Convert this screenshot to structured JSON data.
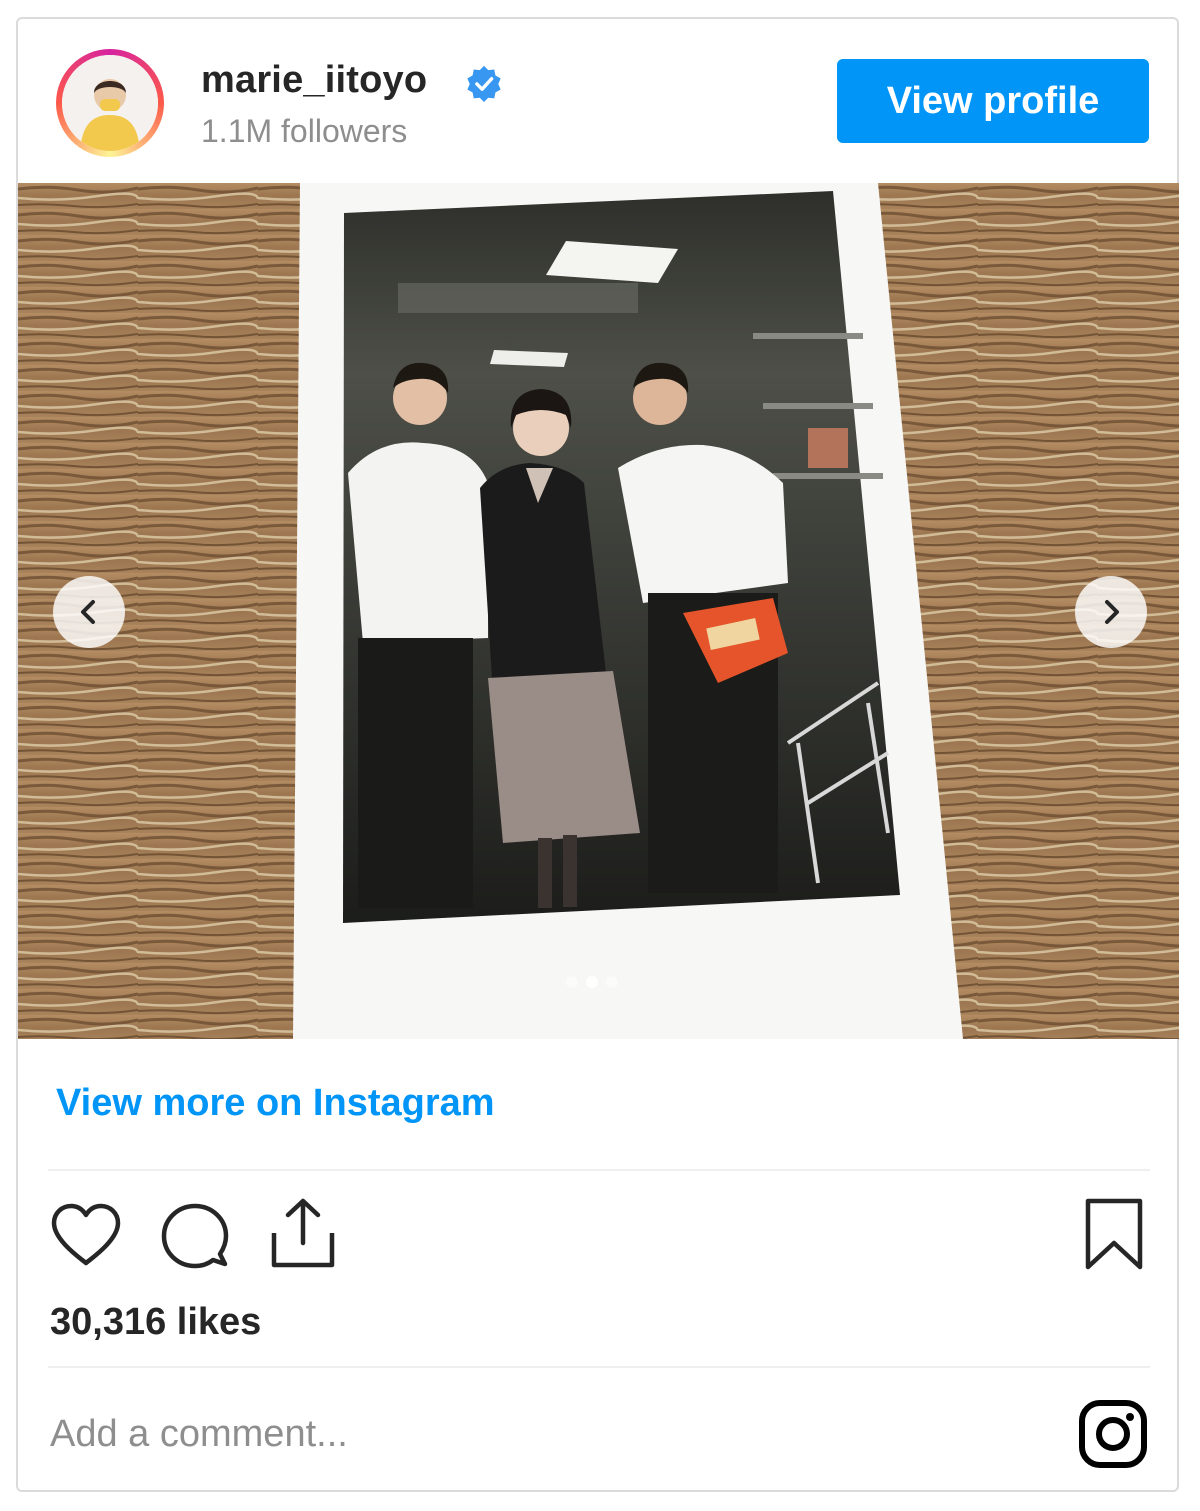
{
  "header": {
    "username": "marie_iitoyo",
    "followers": "1.1M followers",
    "verified": true,
    "view_profile_label": "View profile"
  },
  "media": {
    "carousel_count": 3,
    "carousel_active_index": 2,
    "prev_icon": "chevron-left-icon",
    "next_icon": "chevron-right-icon"
  },
  "links": {
    "view_more": "View more on Instagram"
  },
  "actions": {
    "icons": [
      "heart-icon",
      "comment-icon",
      "share-icon",
      "bookmark-icon"
    ],
    "likes": "30,316 likes"
  },
  "comment": {
    "placeholder": "Add a comment..."
  },
  "colors": {
    "accent": "#0095f6",
    "text": "#262626",
    "secondary_text": "#8e8e8e",
    "border": "#dbdbdb"
  }
}
